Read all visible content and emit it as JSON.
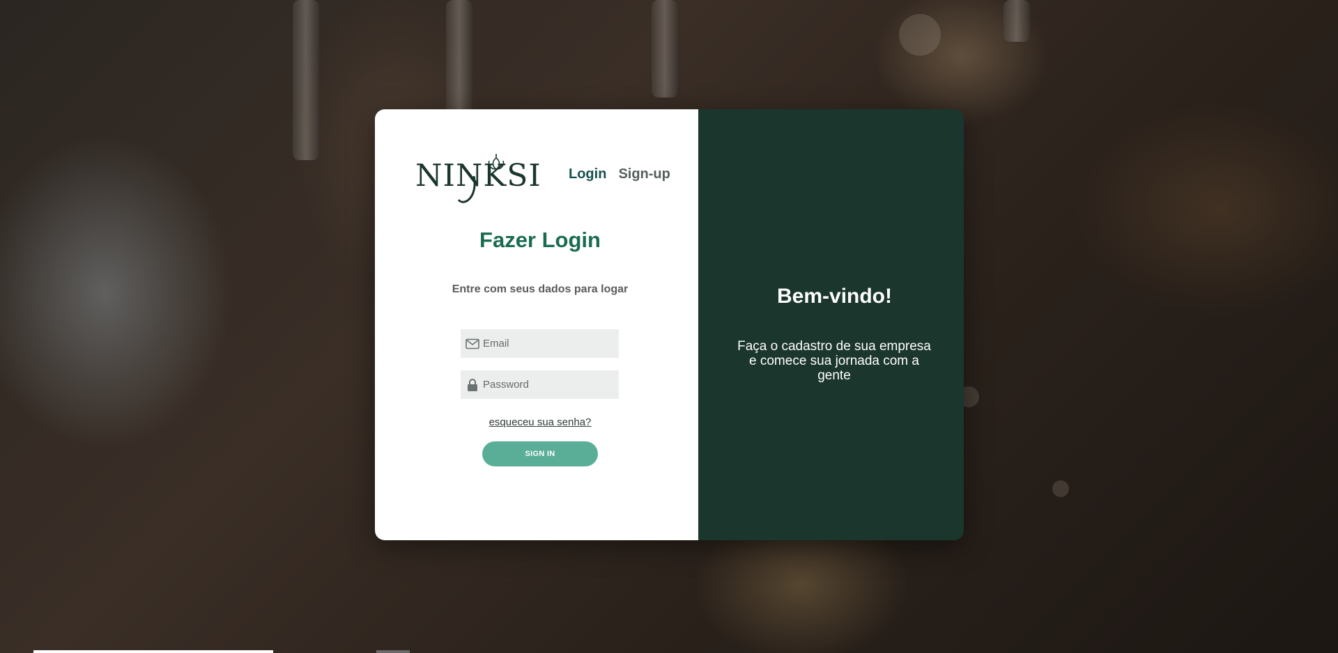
{
  "brand": {
    "logo_text": "NINKSI"
  },
  "nav": {
    "login_label": "Login",
    "signup_label": "Sign-up"
  },
  "login": {
    "title": "Fazer Login",
    "subtitle": "Entre com seus dados para logar",
    "email_placeholder": "Email",
    "password_placeholder": "Password",
    "forgot_label": "esqueceu sua senha?",
    "signin_label": "SIGN IN"
  },
  "welcome": {
    "title": "Bem-vindo!",
    "text": "Faça o cadastro de sua empresa e comece sua jornada com a gente"
  },
  "icons": {
    "email": "envelope-icon",
    "password": "lock-icon",
    "logo_leaf": "hop-leaf-icon"
  },
  "colors": {
    "brand_dark": "#1b362c",
    "title_green": "#1a6b52",
    "button": "#5aae98",
    "nav_active": "#16504c"
  }
}
